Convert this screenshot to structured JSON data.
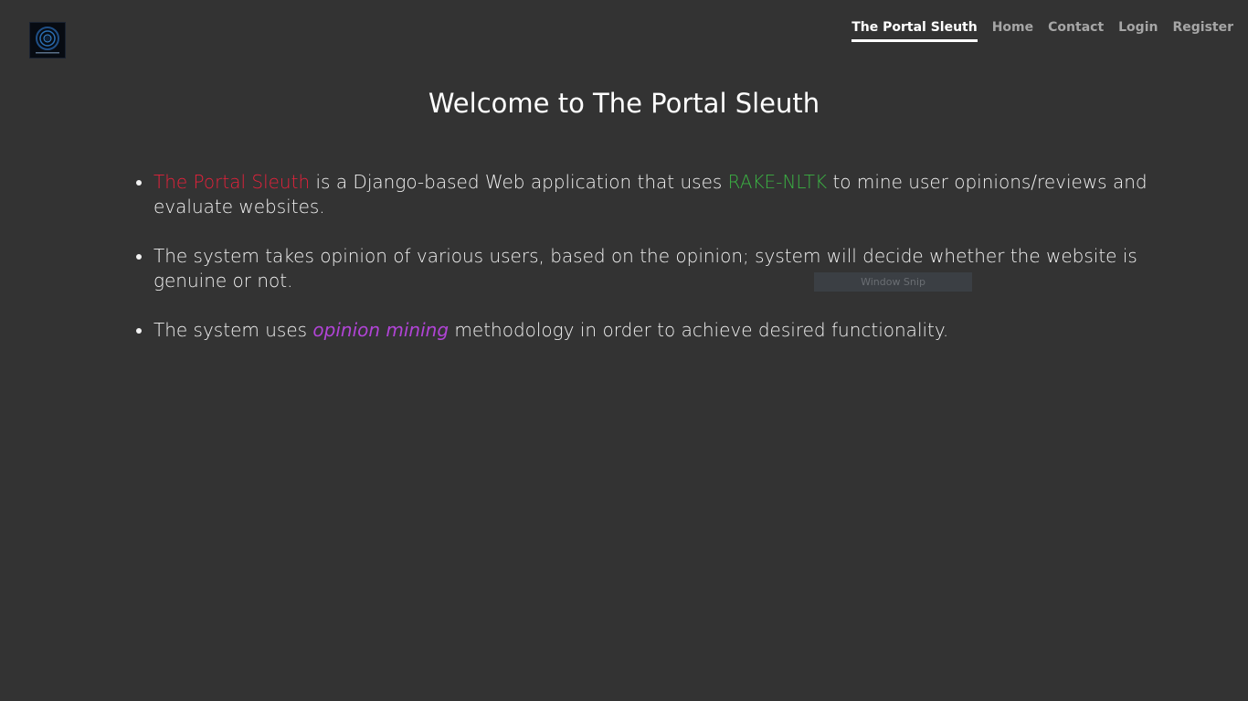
{
  "brand": {
    "logo_icon": "portal-logo-icon",
    "colors": {
      "background": "#333333",
      "highlight_red": "#e8213b",
      "highlight_green": "#3bb143",
      "highlight_purple": "#b144d6"
    }
  },
  "nav": {
    "items": [
      {
        "label": "The Portal Sleuth",
        "active": true
      },
      {
        "label": "Home",
        "active": false
      },
      {
        "label": "Contact",
        "active": false
      },
      {
        "label": "Login",
        "active": false
      },
      {
        "label": "Register",
        "active": false
      }
    ]
  },
  "main": {
    "title": "Welcome to The Portal Sleuth",
    "points": [
      {
        "highlight": "The Portal Sleuth",
        "text_a": " is a Django-based Web application that uses ",
        "highlight_b": "RAKE-NLTK",
        "text_b": " to mine user opinions/reviews and evaluate websites."
      },
      {
        "text": "The system takes opinion of various users, based on the opinion; system will decide whether the website is genuine or not."
      },
      {
        "text_a": "The system uses ",
        "highlight": "opinion mining",
        "text_b": " methodology in order to achieve desired functionality."
      }
    ]
  },
  "overlay": {
    "snip_label": "Window Snip"
  }
}
